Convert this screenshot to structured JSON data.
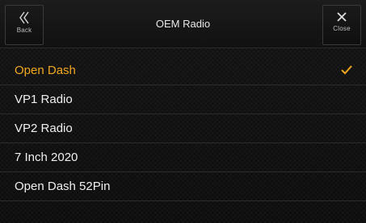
{
  "header": {
    "back_label": "Back",
    "title": "OEM Radio",
    "close_label": "Close"
  },
  "list": {
    "items": [
      {
        "label": "Open Dash",
        "selected": true
      },
      {
        "label": "VP1 Radio",
        "selected": false
      },
      {
        "label": "VP2 Radio",
        "selected": false
      },
      {
        "label": "7 Inch 2020",
        "selected": false
      },
      {
        "label": "Open Dash 52Pin",
        "selected": false
      }
    ]
  },
  "colors": {
    "accent": "#f2a81d",
    "background": "#0e0e0e",
    "text": "#f0f0f0"
  },
  "icons": {
    "back": "double-chevron-left-icon",
    "close": "close-icon",
    "selected": "checkmark-icon"
  }
}
